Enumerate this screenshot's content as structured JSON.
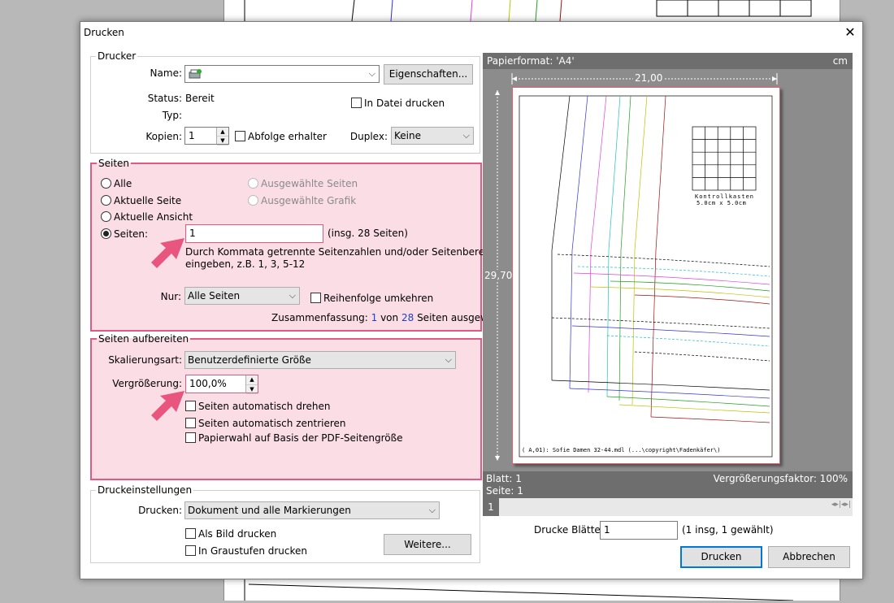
{
  "dialog": {
    "title": "Drucken",
    "close_glyph": "✕"
  },
  "printer": {
    "legend": "Drucker",
    "name_label": "Name:",
    "name_value": "",
    "properties_button": "Eigenschaften...",
    "status_label": "Status:",
    "status_value": "Bereit",
    "type_label": "Typ:",
    "type_value": "",
    "print_to_file_label": "In Datei drucken",
    "copies_label": "Kopien:",
    "copies_value": "1",
    "collate_label": "Abfolge erhalter",
    "duplex_label": "Duplex:",
    "duplex_value": "Keine"
  },
  "pages": {
    "legend": "Seiten",
    "opt_all": "Alle",
    "opt_current_page": "Aktuelle Seite",
    "opt_current_view": "Aktuelle Ansicht",
    "opt_pages": "Seiten:",
    "opt_selected_pages": "Ausgewählte Seiten",
    "opt_selected_graphic": "Ausgewählte Grafik",
    "pages_value": "1",
    "total_pages_note": "(insg. 28 Seiten)",
    "hint_line1": "Durch Kommata getrennte Seitenzahlen und/oder Seitenbereiche",
    "hint_line2": "eingeben, z.B. 1, 3, 5-12",
    "only_label": "Nur:",
    "only_value": "Alle Seiten",
    "reverse_label": "Reihenfolge umkehren",
    "summary_prefix": "Zusammenfassung:",
    "summary_selected": "1",
    "summary_of": "von",
    "summary_total": "28",
    "summary_suffix": "Seiten ausgewählt"
  },
  "processing": {
    "legend": "Seiten aufbereiten",
    "scaling_label": "Skalierungsart:",
    "scaling_value": "Benutzerdefinierte Größe",
    "zoom_label": "Vergrößerung:",
    "zoom_value": "100,0%",
    "auto_rotate": "Seiten automatisch drehen",
    "auto_center": "Seiten automatisch zentrieren",
    "paper_by_pdf": "Papierwahl auf Basis der PDF-Seitengröße"
  },
  "print_settings": {
    "legend": "Druckeinstellungen",
    "print_label": "Drucken:",
    "print_value": "Dokument und alle Markierungen",
    "as_image": "Als Bild drucken",
    "grayscale": "In Graustufen drucken",
    "more_button": "Weitere..."
  },
  "preview": {
    "paper_format": "Papierformat: 'A4'",
    "unit": "cm",
    "width_label": "21,00",
    "height_label": "29,70",
    "sheet_label": "Blatt: 1",
    "page_label": "Seite: 1",
    "scale_factor": "Vergrößerungsfaktor: 100%",
    "scroll_page": "1",
    "grid_label_line1": "Kontrollkasten",
    "grid_label_line2": "5.0cm x 5.0cm",
    "footer_text": "( A,01): Sofie Damen 32-44.mdl (...\\copyright\\Fadenkäfer\\)"
  },
  "bottom": {
    "print_sheets_label": "Drucke Blätter:",
    "print_sheets_value": "1",
    "print_sheets_note": "(1 insg, 1 gewählt)",
    "print_button": "Drucken",
    "cancel_button": "Abbrechen"
  },
  "colors": {
    "highlight": "#e05a83",
    "highlight_bg": "#fbdde6",
    "arrow": "#e8557f",
    "accent": "#0078d7"
  }
}
